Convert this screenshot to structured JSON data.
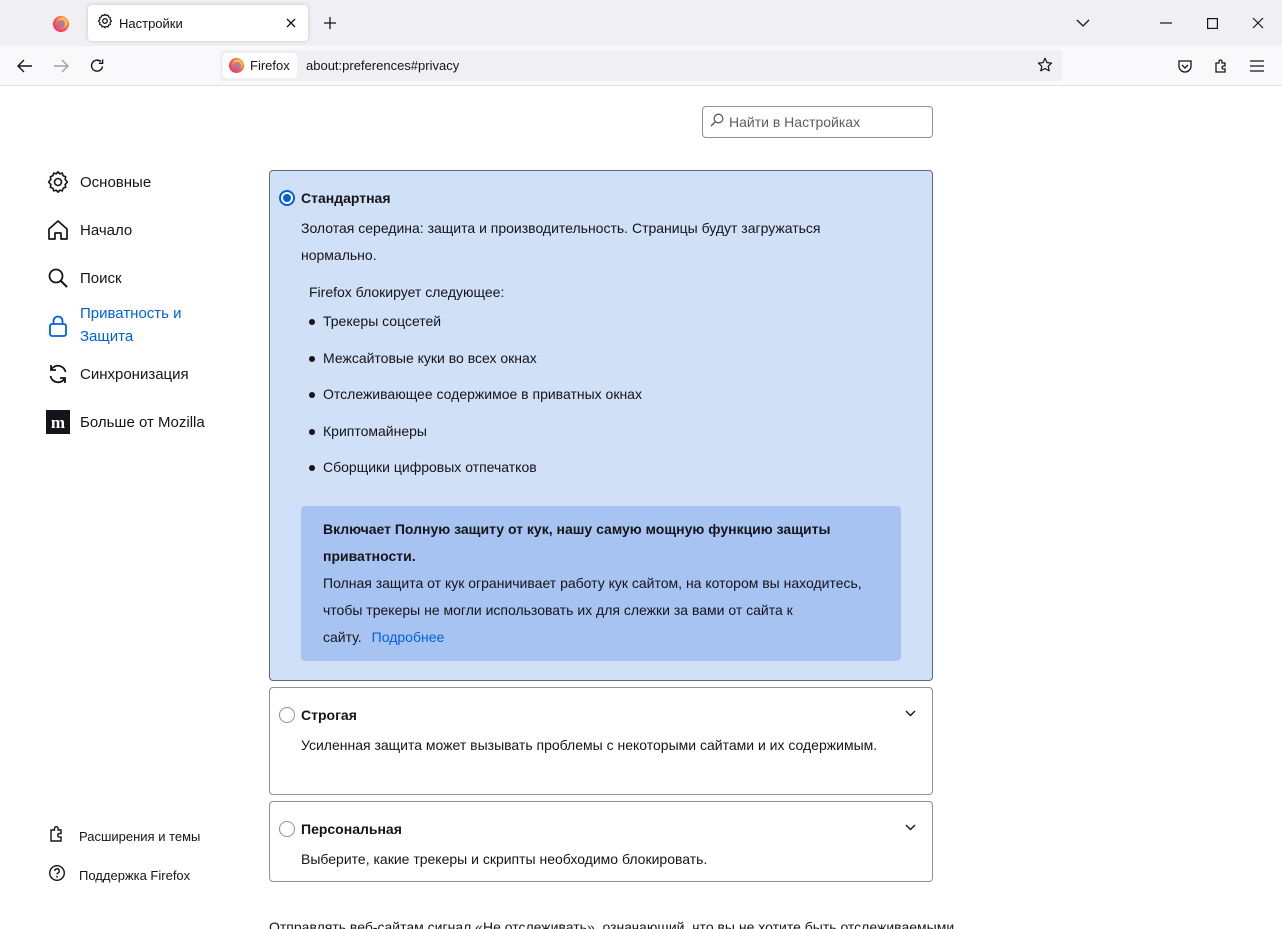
{
  "tabs": {
    "active_title": "Настройки"
  },
  "nav": {
    "identity_label": "Firefox",
    "url": "about:preferences#privacy"
  },
  "search": {
    "placeholder": "Найти в Настройках"
  },
  "sidebar": {
    "categories": [
      {
        "label": "Основные",
        "icon": "gear-icon"
      },
      {
        "label": "Начало",
        "icon": "home-icon"
      },
      {
        "label": "Поиск",
        "icon": "search-icon"
      },
      {
        "label": "Приватность и Защита",
        "icon": "lock-icon",
        "selected": true
      },
      {
        "label": "Синхронизация",
        "icon": "sync-icon"
      },
      {
        "label": "Больше от Mozilla",
        "icon": "mozilla-icon"
      }
    ],
    "footer": [
      {
        "label": "Расширения и темы",
        "icon": "puzzle-icon"
      },
      {
        "label": "Поддержка Firefox",
        "icon": "help-icon"
      }
    ]
  },
  "protection": {
    "standard": {
      "title": "Стандартная",
      "description": "Золотая середина: защита и производительность. Страницы будут загружаться нормально.",
      "blocks_heading": "Firefox блокирует следующее:",
      "blocked_items": [
        "Трекеры соцсетей",
        "Межсайтовые куки во всех окнах",
        "Отслеживающее содержимое в приватных окнах",
        "Криптомайнеры",
        "Сборщики цифровых отпечатков"
      ],
      "tcp_heading": "Включает Полную защиту от кук, нашу самую мощную функцию защиты приватности.",
      "tcp_text": "Полная защита от кук ограничивает работу кук сайтом, на котором вы находитесь, чтобы трекеры не могли использовать их для слежки за вами от сайта к сайту.",
      "learn_more": "Подробнее"
    },
    "strict": {
      "title": "Строгая",
      "description": "Усиленная защита может вызывать проблемы с некоторыми сайтами и их содержимым."
    },
    "custom": {
      "title": "Персональная",
      "description": "Выберите, какие трекеры и скрипты необходимо блокировать."
    }
  },
  "footer_text": "Отправлять веб-сайтам сигнал «Не отслеживать», означающий, что вы не хотите быть отслеживаемыми",
  "colors": {
    "accent": "#0061e0",
    "selected_bg": "#cfe0f7",
    "info_box_bg": "#a7c3f1"
  }
}
